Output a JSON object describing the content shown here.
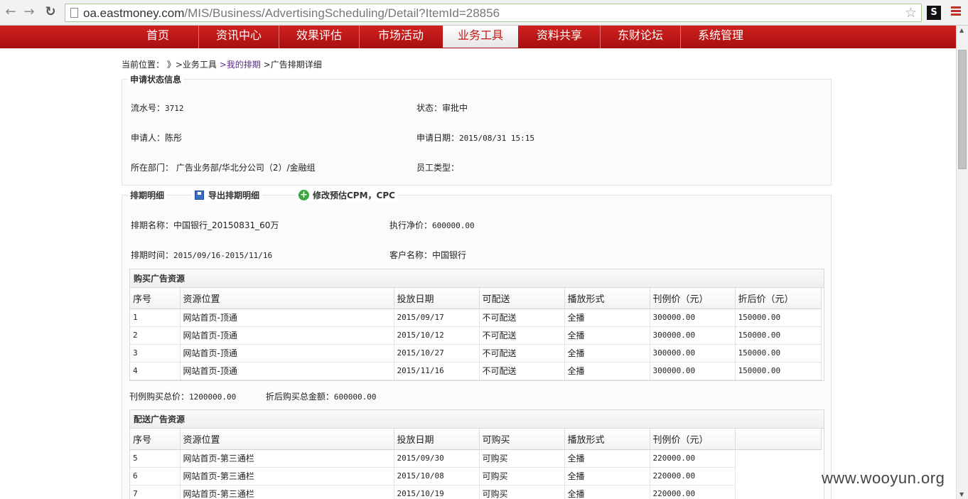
{
  "browser": {
    "url_host": "oa.eastmoney.com",
    "url_path": "/MIS/Business/AdvertisingScheduling/Detail?ItemId=28856",
    "ext_label": "S"
  },
  "nav": {
    "items": [
      "首页",
      "资讯中心",
      "效果评估",
      "市场活动",
      "业务工具",
      "资料共享",
      "东财论坛",
      "系统管理"
    ],
    "active_index": 4
  },
  "breadcrumb": {
    "prefix": "当前位置：",
    "sep1": "》",
    "crumb1": ">业务工具",
    "crumb2": ">我的排期",
    "crumb3": ">广告排期详细"
  },
  "status": {
    "legend": "申请状态信息",
    "serial_label": "流水号：",
    "serial_value": "3712",
    "state_label": "状态：",
    "state_value": "审批中",
    "applicant_label": "申请人：",
    "applicant_value": "陈彤",
    "date_label": "申请日期：",
    "date_value": "2015/08/31 15:15",
    "dept_label": "所在部门：",
    "dept_value": "广告业务部/华北分公司（2）/金融组",
    "staff_type_label": "员工类型："
  },
  "schedule": {
    "legend": "排期明细",
    "export_label": "导出排期明细",
    "edit_label": "修改预估CPM，CPC",
    "name_label": "排期名称：",
    "name_value": "中国银行_20150831_60万",
    "net_price_label": "执行净价：",
    "net_price_value": "600000.00",
    "time_label": "排期时间：",
    "time_value": "2015/09/16-2015/11/16",
    "client_label": "客户名称：",
    "client_value": "中国银行"
  },
  "purchased": {
    "title": "购买广告资源",
    "headers": [
      "序号",
      "资源位置",
      "投放日期",
      "可配送",
      "播放形式",
      "刊例价（元）",
      "折后价（元）"
    ],
    "rows": [
      [
        "1",
        "网站首页-顶通",
        "2015/09/17",
        "不可配送",
        "全播",
        "300000.00",
        "150000.00"
      ],
      [
        "2",
        "网站首页-顶通",
        "2015/10/12",
        "不可配送",
        "全播",
        "300000.00",
        "150000.00"
      ],
      [
        "3",
        "网站首页-顶通",
        "2015/10/27",
        "不可配送",
        "全播",
        "300000.00",
        "150000.00"
      ],
      [
        "4",
        "网站首页-顶通",
        "2015/11/16",
        "不可配送",
        "全播",
        "300000.00",
        "150000.00"
      ]
    ]
  },
  "summary": {
    "list_total_label": "刊例购买总价：",
    "list_total_value": "1200000.00",
    "discount_total_label": "折后购买总金额：",
    "discount_total_value": "600000.00"
  },
  "bonus": {
    "title": "配送广告资源",
    "headers": [
      "序号",
      "资源位置",
      "投放日期",
      "可购买",
      "播放形式",
      "刊例价（元）",
      ""
    ],
    "rows": [
      [
        "5",
        "网站首页-第三通栏",
        "2015/09/30",
        "可购买",
        "全播",
        "220000.00"
      ],
      [
        "6",
        "网站首页-第三通栏",
        "2015/10/08",
        "可购买",
        "全播",
        "220000.00"
      ],
      [
        "7",
        "网站首页-第三通栏",
        "2015/10/19",
        "可购买",
        "全播",
        "220000.00"
      ]
    ]
  },
  "watermark": "www.wooyun.org"
}
